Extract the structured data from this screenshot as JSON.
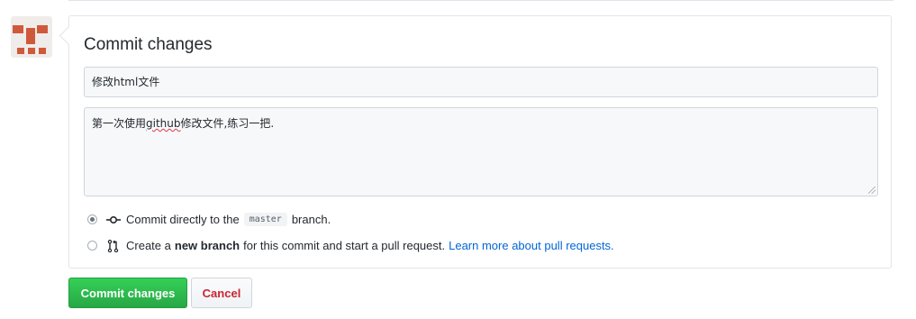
{
  "form": {
    "title": "Commit changes",
    "summary_value": "修改html文件",
    "description_before": "第一次使用",
    "description_flagged": "github",
    "description_after": "修改文件,练习一把."
  },
  "options": {
    "direct": {
      "selected": true,
      "icon": "git-commit-icon",
      "text_before": "Commit directly to the",
      "branch": "master",
      "text_after": "branch."
    },
    "new_branch": {
      "selected": false,
      "icon": "git-pull-request-icon",
      "text_before": "Create a",
      "bold": "new branch",
      "text_after": "for this commit and start a pull request.",
      "link": "Learn more about pull requests."
    }
  },
  "buttons": {
    "commit": "Commit changes",
    "cancel": "Cancel"
  },
  "colors": {
    "accent_green": "#28a745",
    "link_blue": "#0366d6",
    "cancel_red": "#cb2431",
    "avatar": "#cf5a3b"
  }
}
